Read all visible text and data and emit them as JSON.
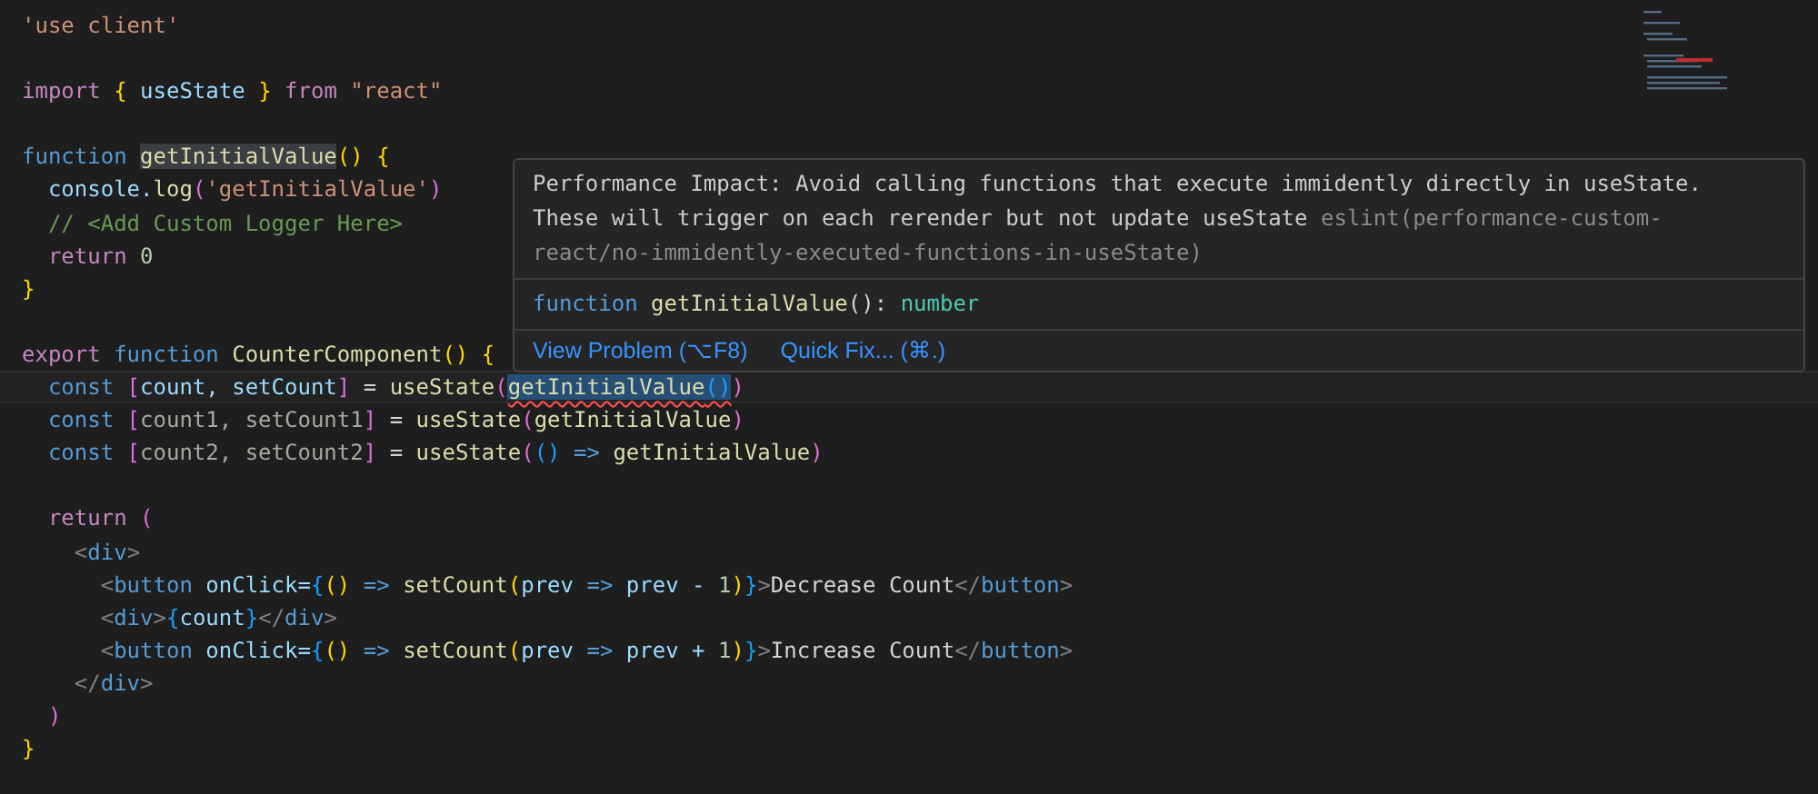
{
  "editor": {
    "lines": [
      {
        "current": false,
        "tokens": [
          {
            "kind": "string",
            "text": "'use client'"
          }
        ]
      },
      {
        "current": false
      },
      {
        "current": false,
        "tokens": [
          {
            "kind": "control",
            "text": "import "
          },
          {
            "kind": "bracket1",
            "text": "{ "
          },
          {
            "kind": "variable",
            "text": "useState "
          },
          {
            "kind": "bracket1",
            "text": "} "
          },
          {
            "kind": "control",
            "text": "from "
          },
          {
            "kind": "string",
            "text": "\"react\""
          }
        ]
      },
      {
        "current": false
      },
      {
        "current": false,
        "tokens": [
          {
            "kind": "keyword",
            "text": "function "
          },
          {
            "kind": "highlighted-function",
            "text": "getInitialValue"
          },
          {
            "kind": "bracket1",
            "text": "() {"
          }
        ]
      },
      {
        "current": false,
        "tokens": [
          {
            "kind": "variable",
            "text": "  console."
          },
          {
            "kind": "function",
            "text": "log"
          },
          {
            "kind": "bracket2",
            "text": "("
          },
          {
            "kind": "string",
            "text": "'getInitialValue'"
          },
          {
            "kind": "bracket2",
            "text": ")"
          }
        ]
      },
      {
        "current": false,
        "tokens": [
          {
            "kind": "comment",
            "text": "  // <Add Custom Logger Here>"
          }
        ]
      },
      {
        "current": false,
        "tokens": [
          {
            "kind": "control",
            "text": "  return "
          },
          {
            "kind": "number",
            "text": "0"
          }
        ]
      },
      {
        "current": false,
        "tokens": [
          {
            "kind": "bracket1",
            "text": "}"
          }
        ]
      },
      {
        "current": false
      },
      {
        "current": false,
        "tokens": [
          {
            "kind": "control",
            "text": "export "
          },
          {
            "kind": "keyword",
            "text": "function "
          },
          {
            "kind": "function",
            "text": "CounterComponent"
          },
          {
            "kind": "bracket1",
            "text": "() {"
          }
        ]
      },
      {
        "current": true,
        "tokens": [
          {
            "kind": "keyword",
            "text": "  const "
          },
          {
            "kind": "bracket2",
            "text": "["
          },
          {
            "kind": "variable",
            "text": "count, setCount"
          },
          {
            "kind": "bracket2",
            "text": "]"
          },
          {
            "kind": "plain",
            "text": " = "
          },
          {
            "kind": "function",
            "text": "useState"
          },
          {
            "kind": "bracket2",
            "text": "("
          },
          {
            "kind": "error-selected-function",
            "text": "getInitialValue"
          },
          {
            "kind": "error-selected-bracket",
            "text": "()"
          },
          {
            "kind": "bracket2",
            "text": ")"
          }
        ]
      },
      {
        "current": false,
        "tokens": [
          {
            "kind": "keyword",
            "text": "  const "
          },
          {
            "kind": "bracket2",
            "text": "["
          },
          {
            "kind": "unused",
            "text": "count1, setCount1"
          },
          {
            "kind": "bracket2",
            "text": "]"
          },
          {
            "kind": "plain",
            "text": " = "
          },
          {
            "kind": "function",
            "text": "useState"
          },
          {
            "kind": "bracket2",
            "text": "("
          },
          {
            "kind": "function",
            "text": "getInitialValue"
          },
          {
            "kind": "bracket2",
            "text": ")"
          }
        ]
      },
      {
        "current": false,
        "tokens": [
          {
            "kind": "keyword",
            "text": "  const "
          },
          {
            "kind": "bracket2",
            "text": "["
          },
          {
            "kind": "unused",
            "text": "count2, setCount2"
          },
          {
            "kind": "bracket2",
            "text": "]"
          },
          {
            "kind": "plain",
            "text": " = "
          },
          {
            "kind": "function",
            "text": "useState"
          },
          {
            "kind": "bracket2",
            "text": "("
          },
          {
            "kind": "bracket3",
            "text": "() "
          },
          {
            "kind": "keyword",
            "text": "=> "
          },
          {
            "kind": "function",
            "text": "getInitialValue"
          },
          {
            "kind": "bracket2",
            "text": ")"
          }
        ]
      },
      {
        "current": false
      },
      {
        "current": false,
        "tokens": [
          {
            "kind": "control",
            "text": "  return "
          },
          {
            "kind": "bracket2",
            "text": "("
          }
        ]
      },
      {
        "current": false,
        "tokens": [
          {
            "kind": "tag",
            "text": "    <"
          },
          {
            "kind": "keyword",
            "text": "div"
          },
          {
            "kind": "tag",
            "text": ">"
          }
        ]
      },
      {
        "current": false,
        "tokens": [
          {
            "kind": "tag",
            "text": "      <"
          },
          {
            "kind": "keyword",
            "text": "button "
          },
          {
            "kind": "variable",
            "text": "onClick="
          },
          {
            "kind": "bracket3",
            "text": "{"
          },
          {
            "kind": "bracket1",
            "text": "() "
          },
          {
            "kind": "keyword",
            "text": "=> "
          },
          {
            "kind": "function",
            "text": "setCount"
          },
          {
            "kind": "bracket1",
            "text": "("
          },
          {
            "kind": "variable",
            "text": "prev "
          },
          {
            "kind": "keyword",
            "text": "=> "
          },
          {
            "kind": "variable",
            "text": "prev - "
          },
          {
            "kind": "number",
            "text": "1"
          },
          {
            "kind": "bracket1",
            "text": ")"
          },
          {
            "kind": "bracket3",
            "text": "}"
          },
          {
            "kind": "tag",
            "text": ">"
          },
          {
            "kind": "plain",
            "text": "Decrease Count"
          },
          {
            "kind": "tag",
            "text": "</"
          },
          {
            "kind": "keyword",
            "text": "button"
          },
          {
            "kind": "tag",
            "text": ">"
          }
        ]
      },
      {
        "current": false,
        "tokens": [
          {
            "kind": "tag",
            "text": "      <"
          },
          {
            "kind": "keyword",
            "text": "div"
          },
          {
            "kind": "tag",
            "text": ">"
          },
          {
            "kind": "bracket3",
            "text": "{"
          },
          {
            "kind": "variable",
            "text": "count"
          },
          {
            "kind": "bracket3",
            "text": "}"
          },
          {
            "kind": "tag",
            "text": "</"
          },
          {
            "kind": "keyword",
            "text": "div"
          },
          {
            "kind": "tag",
            "text": ">"
          }
        ]
      },
      {
        "current": false,
        "tokens": [
          {
            "kind": "tag",
            "text": "      <"
          },
          {
            "kind": "keyword",
            "text": "button "
          },
          {
            "kind": "variable",
            "text": "onClick="
          },
          {
            "kind": "bracket3",
            "text": "{"
          },
          {
            "kind": "bracket1",
            "text": "() "
          },
          {
            "kind": "keyword",
            "text": "=> "
          },
          {
            "kind": "function",
            "text": "setCount"
          },
          {
            "kind": "bracket1",
            "text": "("
          },
          {
            "kind": "variable",
            "text": "prev "
          },
          {
            "kind": "keyword",
            "text": "=> "
          },
          {
            "kind": "variable",
            "text": "prev + "
          },
          {
            "kind": "number",
            "text": "1"
          },
          {
            "kind": "bracket1",
            "text": ")"
          },
          {
            "kind": "bracket3",
            "text": "}"
          },
          {
            "kind": "tag",
            "text": ">"
          },
          {
            "kind": "plain",
            "text": "Increase Count"
          },
          {
            "kind": "tag",
            "text": "</"
          },
          {
            "kind": "keyword",
            "text": "button"
          },
          {
            "kind": "tag",
            "text": ">"
          }
        ]
      },
      {
        "current": false,
        "tokens": [
          {
            "kind": "tag",
            "text": "    </"
          },
          {
            "kind": "keyword",
            "text": "div"
          },
          {
            "kind": "tag",
            "text": ">"
          }
        ]
      },
      {
        "current": false,
        "tokens": [
          {
            "kind": "bracket2",
            "text": "  )"
          }
        ]
      },
      {
        "current": false,
        "tokens": [
          {
            "kind": "bracket1",
            "text": "}"
          }
        ]
      }
    ]
  },
  "hover": {
    "message": "Performance Impact: Avoid calling functions that execute immidently directly in useState. These will trigger on each rerender but not update useState",
    "source": "eslint(performance-custom-react/no-immidently-executed-functions-in-useState)",
    "signature": [
      {
        "kind": "keyword",
        "text": "function "
      },
      {
        "kind": "function",
        "text": "getInitialValue"
      },
      {
        "kind": "plain",
        "text": "(): "
      },
      {
        "kind": "type",
        "text": "number"
      }
    ],
    "actions": [
      {
        "label": "View Problem (⌥F8)"
      },
      {
        "label": "Quick Fix... (⌘.)"
      }
    ]
  }
}
